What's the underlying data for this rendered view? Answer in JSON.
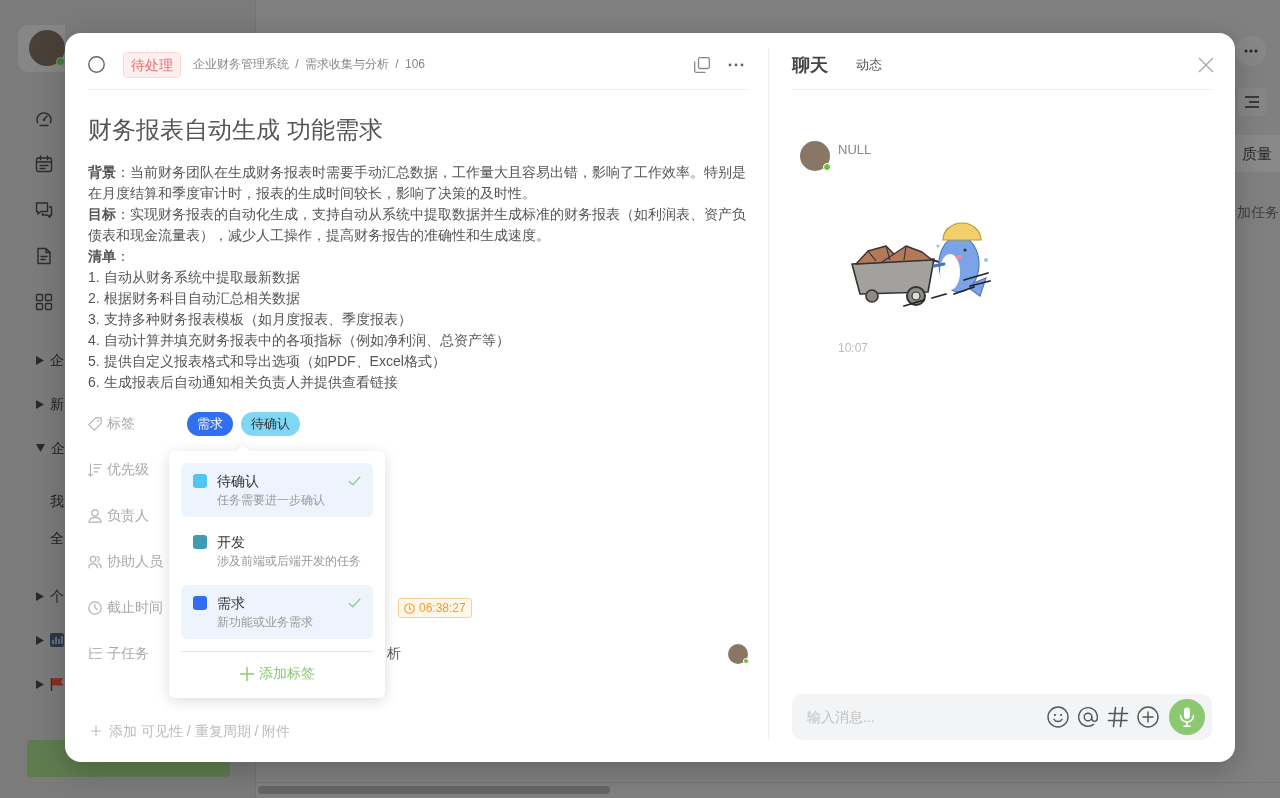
{
  "app_background": {
    "sidebar": {
      "profile_online": true,
      "tree": [
        {
          "kind": "text",
          "label": "企",
          "expanded": false
        },
        {
          "kind": "text",
          "label": "新",
          "expanded": false
        },
        {
          "kind": "text",
          "label": "企",
          "expanded": true,
          "children": [
            {
              "label": "我"
            },
            {
              "label": "全"
            }
          ]
        },
        {
          "kind": "text",
          "label": "个",
          "expanded": false
        },
        {
          "kind": "chart",
          "expanded": false
        },
        {
          "kind": "flag",
          "expanded": false
        }
      ]
    },
    "board": {
      "column_header": "质量",
      "add_task": "加任务"
    }
  },
  "task": {
    "done": false,
    "status": "待处理",
    "breadcrumb": "企业财务管理系统 / 需求收集与分析 / 106",
    "title": "财务报表自动生成 功能需求",
    "description": [
      "**背景**：当前财务团队在生成财务报表时需要手动汇总数据，工作量大且容易出错，影响了工作效率。特别是在月度结算和季度审计时，报表的生成时间较长，影响了决策的及时性。",
      "**目标**：实现财务报表的自动化生成，支持自动从系统中提取数据并生成标准的财务报表（如利润表、资产负债表和现金流量表），减少人工操作，提高财务报告的准确性和生成速度。",
      "**清单**：",
      "1. 自动从财务系统中提取最新数据",
      "2. 根据财务科目自动汇总相关数据",
      "3. 支持多种财务报表模板（如月度报表、季度报表）",
      "4. 自动计算并填充财务报表中的各项指标（例如净利润、总资产等）",
      "5. 提供自定义报表格式和导出选项（如PDF、Excel格式）",
      "6. 生成报表后自动通知相关负责人并提供查看链接"
    ],
    "fields": [
      {
        "kind": "tags",
        "label": "标签",
        "tags": [
          {
            "text": "需求",
            "color": "#2f6ff0"
          },
          {
            "text": "待确认",
            "color": "#80d7f3"
          }
        ]
      },
      {
        "kind": "priority",
        "label": "优先级"
      },
      {
        "kind": "assignee",
        "label": "负责人"
      },
      {
        "kind": "collaborators",
        "label": "协助人员"
      },
      {
        "kind": "deadline",
        "label": "截止时间",
        "countdown": "06:38:27"
      },
      {
        "kind": "subtasks",
        "label": "子任务",
        "value": "析",
        "avatar_online": true
      }
    ],
    "add_more": "添加 可见性 / 重复周期 / 附件"
  },
  "tag_dropdown": {
    "options": [
      {
        "name": "待确认",
        "description": "任务需要进一步确认",
        "color": "#52c5ee",
        "selected": true
      },
      {
        "name": "开发",
        "description": "涉及前端或后端开发的任务",
        "color": "#3f9cb5",
        "selected": false
      },
      {
        "name": "需求",
        "description": "新功能或业务需求",
        "color": "#2f6ff0",
        "selected": true
      }
    ],
    "add_label": "添加标签"
  },
  "chat": {
    "tabs": [
      {
        "label": "聊天",
        "selected": true
      },
      {
        "label": "动态",
        "selected": false
      }
    ],
    "messages": [
      {
        "author": "NULL",
        "online": true,
        "kind": "sticker",
        "time": "10:07"
      }
    ],
    "input": {
      "placeholder": "输入消息..."
    }
  }
}
